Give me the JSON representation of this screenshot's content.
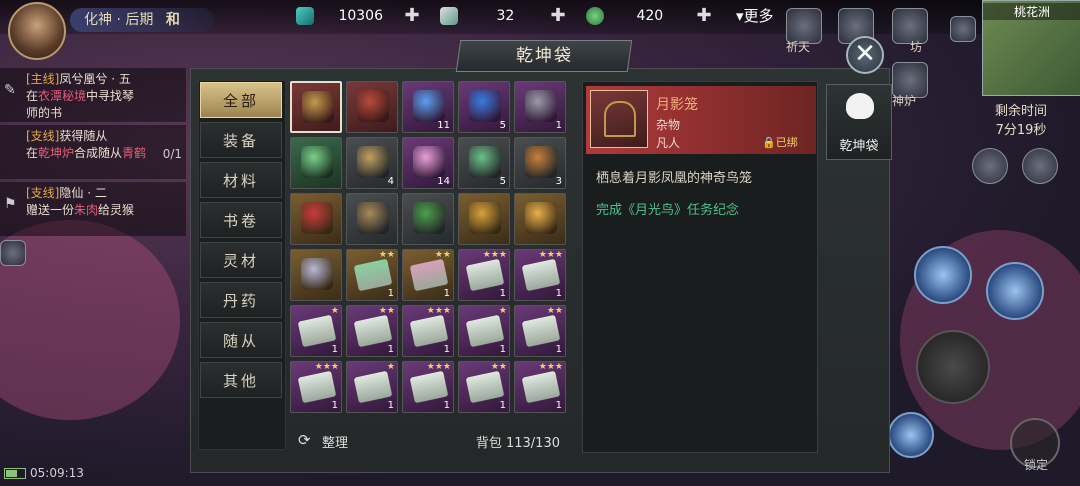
{
  "colors": {
    "accent_gold": "#d8c28a",
    "rarity_red": "#b23a3a",
    "source_green": "#4ec08a",
    "name_orange": "#f2b07a"
  },
  "hud": {
    "realm": "化神 · 后期",
    "realm_glyph": "和",
    "resources": [
      {
        "icon": "jade-icon",
        "value": "10306"
      },
      {
        "icon": "scroll-token-icon",
        "value": "32"
      },
      {
        "icon": "spirit-coin-icon",
        "value": "420"
      }
    ],
    "more_label": "更多",
    "top_icons": [
      {
        "label": "祈天"
      },
      {
        "label": "坊"
      },
      {
        "label": "神炉"
      }
    ],
    "minimap_name": "桃花洲",
    "remaining_label": "剩余时间",
    "remaining_value": "7分19秒",
    "clock": "05:09:13",
    "lock_label": "锁定"
  },
  "quests": [
    {
      "tag": "[主线]",
      "title": "凤兮凰兮 · 五",
      "line_prefix": "在",
      "line_hl": "衣潭秘境",
      "line_suffix": "中寻找琴",
      "line2": "师的书",
      "count": ""
    },
    {
      "tag": "[支线]",
      "title": "获得随从",
      "line_prefix": "在",
      "line_hl": "乾坤炉",
      "line_suffix": "合成随从",
      "line2": "青鹤",
      "count": "0/1"
    },
    {
      "tag": "[支线]",
      "title": "隐仙 · 二",
      "line_prefix": "赠送一份",
      "line_hl": "朱肉",
      "line_suffix": "给灵猴",
      "line2": "",
      "count": ""
    }
  ],
  "bag": {
    "title": "乾坤袋",
    "categories": [
      "全部",
      "装备",
      "材料",
      "书卷",
      "灵材",
      "丹药",
      "随从",
      "其他"
    ],
    "active_category": 0,
    "sort_label": "整理",
    "count_label": "背包 113/130",
    "side_tab_label": "乾坤袋"
  },
  "items": [
    {
      "name": "birdcage",
      "rarity": "red",
      "qty": "",
      "stars": "",
      "color": "#c49a4a"
    },
    {
      "name": "token-tablet",
      "rarity": "red",
      "qty": "",
      "stars": "",
      "color": "#b84a3a"
    },
    {
      "name": "spirit-wisp",
      "rarity": "purple",
      "qty": "11",
      "stars": "",
      "color": "#5aa0f0"
    },
    {
      "name": "blue-orb",
      "rarity": "purple",
      "qty": "5",
      "stars": "",
      "color": "#3a7ae0"
    },
    {
      "name": "spear",
      "rarity": "purple",
      "qty": "1",
      "stars": "",
      "color": "#9a9aa8"
    },
    {
      "name": "jade-buddha",
      "rarity": "green",
      "qty": "",
      "stars": "",
      "color": "#7ad08a"
    },
    {
      "name": "bronze-pendant",
      "rarity": "gray",
      "qty": "4",
      "stars": "",
      "color": "#c0a060"
    },
    {
      "name": "pink-pearl",
      "rarity": "purple",
      "qty": "14",
      "stars": "",
      "color": "#e8a0d8"
    },
    {
      "name": "jade-rings",
      "rarity": "gray",
      "qty": "5",
      "stars": "",
      "color": "#6ac08a"
    },
    {
      "name": "roast-fowl",
      "rarity": "gray",
      "qty": "3",
      "stars": "",
      "color": "#c8803a"
    },
    {
      "name": "red-book",
      "rarity": "gold",
      "qty": "",
      "stars": "",
      "color": "#c83a3a"
    },
    {
      "name": "bamboo-rod",
      "rarity": "gray",
      "qty": "",
      "stars": "",
      "color": "#a8885a"
    },
    {
      "name": "bamboo-leaves",
      "rarity": "gray",
      "qty": "",
      "stars": "",
      "color": "#4aa04a"
    },
    {
      "name": "golden-helm",
      "rarity": "gold",
      "qty": "",
      "stars": "",
      "color": "#d8a03a"
    },
    {
      "name": "talisman",
      "rarity": "gold",
      "qty": "",
      "stars": "",
      "color": "#e8b04a"
    },
    {
      "name": "silver-bracelet",
      "rarity": "gold",
      "qty": "",
      "stars": "",
      "color": "#b8b8d8"
    },
    {
      "name": "scroll",
      "rarity": "gold",
      "qty": "1",
      "stars": "★★",
      "color": "#8ad0a0"
    },
    {
      "name": "scroll",
      "rarity": "gold",
      "qty": "1",
      "stars": "★★",
      "color": "#d8a0b8"
    },
    {
      "name": "manual",
      "rarity": "purple",
      "qty": "1",
      "stars": "★★★",
      "color": "#e0e8e0"
    },
    {
      "name": "manual",
      "rarity": "purple",
      "qty": "1",
      "stars": "★★★",
      "color": "#e0e8e0"
    },
    {
      "name": "manual",
      "rarity": "purple",
      "qty": "1",
      "stars": "★",
      "color": "#e0e8e0"
    },
    {
      "name": "manual",
      "rarity": "purple",
      "qty": "1",
      "stars": "★★",
      "color": "#e0e8e0"
    },
    {
      "name": "manual",
      "rarity": "purple",
      "qty": "1",
      "stars": "★★★",
      "color": "#e0e8e0"
    },
    {
      "name": "manual",
      "rarity": "purple",
      "qty": "1",
      "stars": "★",
      "color": "#e0e8e0"
    },
    {
      "name": "manual",
      "rarity": "purple",
      "qty": "1",
      "stars": "★★",
      "color": "#e0e8e0"
    },
    {
      "name": "manual",
      "rarity": "purple",
      "qty": "1",
      "stars": "★★★",
      "color": "#e0e8e0"
    },
    {
      "name": "manual",
      "rarity": "purple",
      "qty": "1",
      "stars": "★",
      "color": "#e0e8e0"
    },
    {
      "name": "manual",
      "rarity": "purple",
      "qty": "1",
      "stars": "★★★",
      "color": "#e0e8e0"
    },
    {
      "name": "manual",
      "rarity": "purple",
      "qty": "1",
      "stars": "★★",
      "color": "#e0e8e0"
    },
    {
      "name": "manual",
      "rarity": "purple",
      "qty": "1",
      "stars": "★★★",
      "color": "#e0e8e0"
    },
    {
      "name": "manual",
      "rarity": "purple",
      "qty": "",
      "stars": "★",
      "color": "#e0e8e0"
    },
    {
      "name": "manual",
      "rarity": "purple",
      "qty": "",
      "stars": "★★",
      "color": "#e0e8e0"
    },
    {
      "name": "manual",
      "rarity": "purple",
      "qty": "",
      "stars": "★★★",
      "color": "#e0e8e0"
    },
    {
      "name": "manual",
      "rarity": "purple",
      "qty": "",
      "stars": "★★★",
      "color": "#e0e8e0"
    },
    {
      "name": "manual",
      "rarity": "purple",
      "qty": "",
      "stars": "★★★",
      "color": "#e0e8e0"
    }
  ],
  "detail": {
    "name": "月影笼",
    "type": "杂物",
    "grade": "凡人",
    "bound": "已绑",
    "description": "栖息着月影凤凰的神奇鸟笼",
    "source": "完成《月光鸟》任务纪念"
  }
}
